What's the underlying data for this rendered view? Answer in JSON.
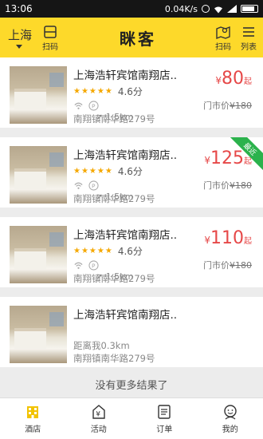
{
  "status_bar": {
    "time": "13:06",
    "speed": "0.04K/s"
  },
  "header": {
    "city": "上海",
    "scan_left_label": "扫码",
    "title": "眯客",
    "scan_right_label": "扫码",
    "list_label": "列表"
  },
  "hotels": [
    {
      "name": "上海浩轩宾馆南翔店..",
      "score": "4.6分",
      "address": "南翔镇南华路279号",
      "distance": "1.5km",
      "price_symbol": "¥",
      "price": "80",
      "price_suffix": "起",
      "market_label": "门市价",
      "market_price": "¥180",
      "badge": ""
    },
    {
      "name": "上海浩轩宾馆南翔店..",
      "score": "4.6分",
      "address": "南翔镇南华路279号",
      "distance": "1.5km",
      "price_symbol": "¥",
      "price": "125",
      "price_suffix": "起",
      "market_label": "门市价",
      "market_price": "¥180",
      "badge": "最近"
    },
    {
      "name": "上海浩轩宾馆南翔店..",
      "score": "4.6分",
      "address": "南翔镇南华路279号",
      "distance": "1.5km",
      "price_symbol": "¥",
      "price": "110",
      "price_suffix": "起",
      "market_label": "门市价",
      "market_price": "¥180",
      "badge": ""
    }
  ],
  "simple_hotel": {
    "name": "上海浩轩宾馆南翔店..",
    "distance_text": "距离我0.3km",
    "address": "南翔镇南华路279号"
  },
  "no_more": "没有更多结果了",
  "tabs": [
    {
      "label": "酒店",
      "icon": "hotel-icon"
    },
    {
      "label": "活动",
      "icon": "activity-icon"
    },
    {
      "label": "订单",
      "icon": "order-icon"
    },
    {
      "label": "我的",
      "icon": "profile-icon"
    }
  ],
  "colors": {
    "header": "#fdd92a",
    "price": "#e64848",
    "stars": "#f5a800",
    "badge": "#2bb24c"
  }
}
